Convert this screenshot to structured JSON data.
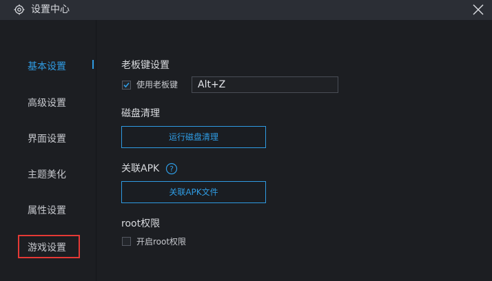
{
  "window": {
    "title": "设置中心",
    "close_glyph": "✕",
    "icons": {
      "title": "gear-icon",
      "close": "close-icon"
    }
  },
  "sidebar": {
    "items": [
      {
        "label": "基本设置",
        "active": true
      },
      {
        "label": "高级设置",
        "active": false
      },
      {
        "label": "界面设置",
        "active": false
      },
      {
        "label": "主题美化",
        "active": false
      },
      {
        "label": "属性设置",
        "active": false
      },
      {
        "label": "游戏设置",
        "active": false,
        "highlighted": true
      }
    ]
  },
  "sections": {
    "boss_key": {
      "title": "老板键设置",
      "checkbox_label": "使用老板键",
      "checked": true,
      "hotkey_value": "Alt+Z"
    },
    "disk_cleanup": {
      "title": "磁盘清理",
      "button_label": "运行磁盘清理"
    },
    "associate_apk": {
      "title": "关联APK",
      "help_glyph": "?",
      "button_label": "关联APK文件"
    },
    "root": {
      "title": "root权限",
      "checkbox_label": "开启root权限",
      "checked": false
    }
  },
  "colors": {
    "accent": "#2f9ce4",
    "highlight_border": "#e53935",
    "background": "#1c1e22",
    "titlebar": "#2b2e35"
  }
}
